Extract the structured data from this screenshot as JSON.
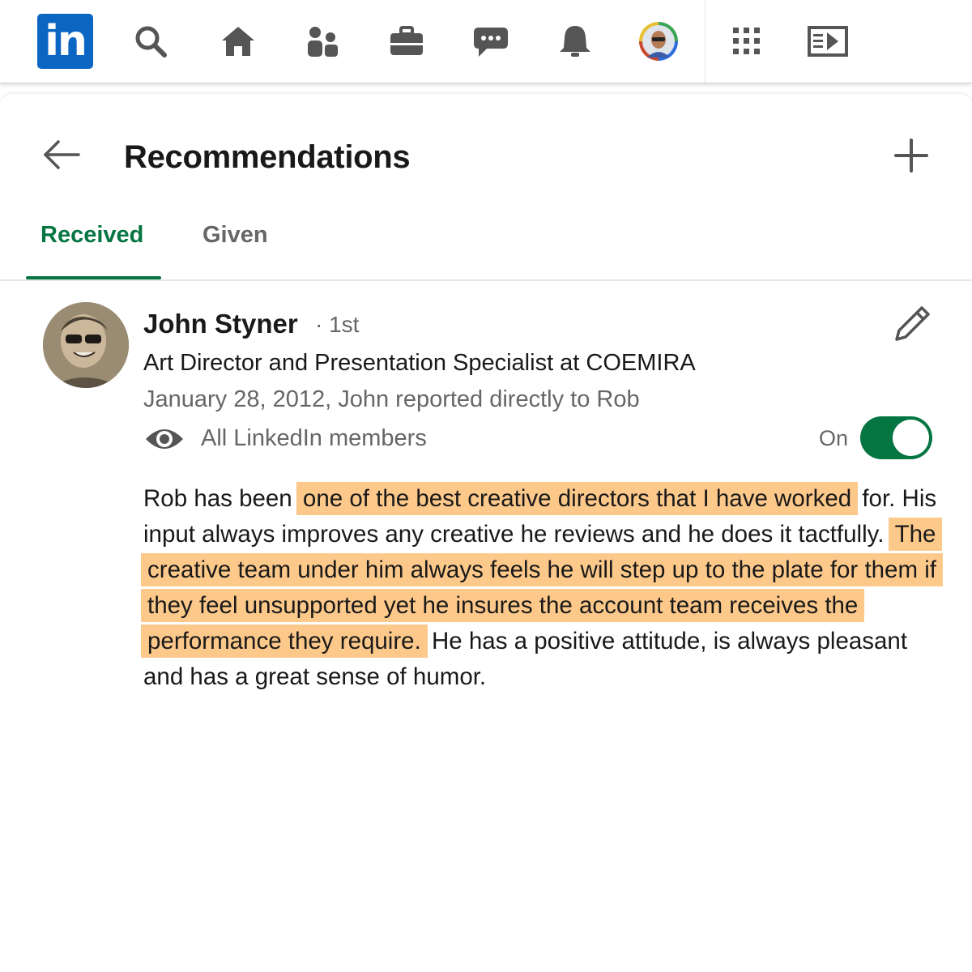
{
  "nav": {
    "logo_text": "in",
    "icons": [
      "search-icon",
      "home-icon",
      "my-network-icon",
      "jobs-icon",
      "messaging-icon",
      "notifications-icon",
      "me-avatar",
      "apps-grid-icon",
      "learning-icon"
    ]
  },
  "header": {
    "title": "Recommendations"
  },
  "tabs": [
    {
      "label": "Received",
      "active": true
    },
    {
      "label": "Given",
      "active": false
    }
  ],
  "recommendation": {
    "name": "John Styner",
    "degree": "· 1st",
    "headline": "Art Director and Presentation Specialist at COEMIRA",
    "meta": "January 28, 2012, John reported directly to Rob",
    "visibility": "All LinkedIn members",
    "toggle_label": "On",
    "toggle_on": true,
    "text_parts": [
      {
        "text": "Rob has been ",
        "highlight": false
      },
      {
        "text": "one of the best creative directors that I have worked",
        "highlight": true
      },
      {
        "text": " for. His input always improves any creative he reviews and he does it tactfully. ",
        "highlight": false
      },
      {
        "text": "The creative team under him always feels he will step up to the plate for them if they feel unsupported yet he insures the account team receives the performance they require.",
        "highlight": true
      },
      {
        "text": " He has a positive attitude, is always pleasant and has a great sense of humor.",
        "highlight": false
      }
    ]
  },
  "colors": {
    "brand": "#0a66c2",
    "accent_green": "#057642",
    "highlight": "#fdc98b",
    "secondary_text": "#666666"
  }
}
